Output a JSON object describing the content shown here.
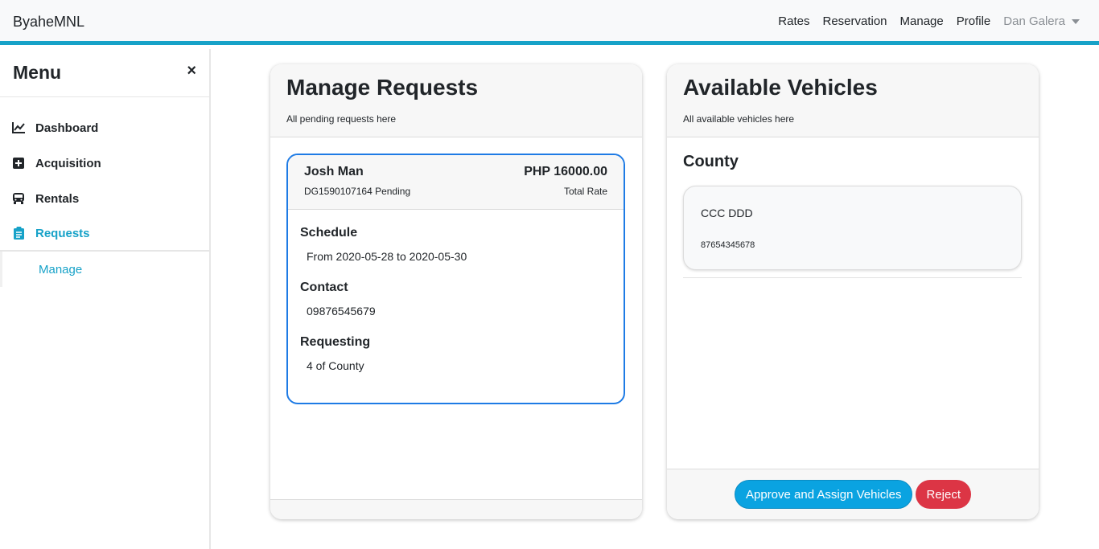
{
  "navbar": {
    "brand": "ByaheMNL",
    "links": [
      "Rates",
      "Reservation",
      "Manage",
      "Profile"
    ],
    "user": "Dan Galera",
    "accent_color": "#17a2c8"
  },
  "sidebar": {
    "title": "Menu",
    "close_label": "×",
    "items": [
      {
        "label": "Dashboard",
        "icon": "chart-line-icon"
      },
      {
        "label": "Acquisition",
        "icon": "plus-square-icon"
      },
      {
        "label": "Rentals",
        "icon": "bus-icon"
      },
      {
        "label": "Requests",
        "icon": "clipboard-icon"
      }
    ],
    "sub_item": "Manage"
  },
  "requests_card": {
    "title": "Manage Requests",
    "subtitle": "All pending requests here",
    "request": {
      "name": "Josh Man",
      "id_status": "DG1590107164 Pending",
      "rate": "PHP 16000.00",
      "rate_label": "Total Rate",
      "schedule_label": "Schedule",
      "schedule": "From 2020-05-28 to 2020-05-30",
      "contact_label": "Contact",
      "contact": "09876545679",
      "requesting_label": "Requesting",
      "requesting": "4 of County"
    }
  },
  "vehicles_card": {
    "title": "Available Vehicles",
    "subtitle": "All available vehicles here",
    "group": "County",
    "vehicle": {
      "name": "CCC DDD",
      "plate": "87654345678"
    },
    "approve_label": "Approve and Assign Vehicles",
    "reject_label": "Reject"
  }
}
